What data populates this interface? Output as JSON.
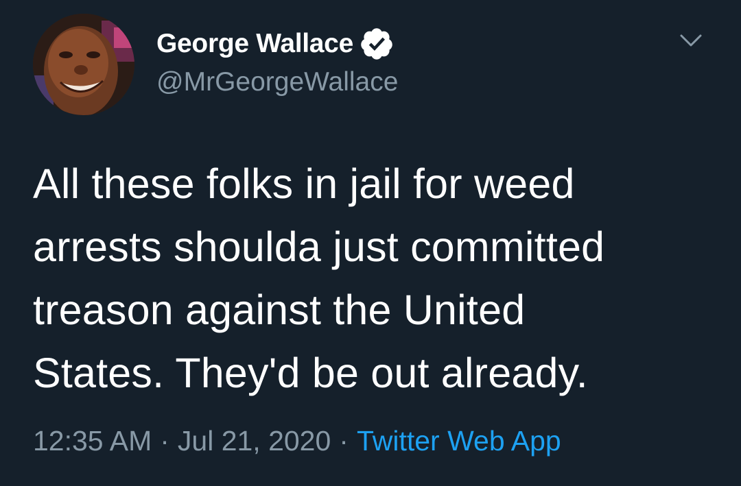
{
  "author": {
    "display_name": "George Wallace",
    "handle": "@MrGeorgeWallace",
    "verified": true,
    "avatar_icon": "profile-photo"
  },
  "tweet": {
    "lines": [
      "All these folks in jail for weed",
      "arrests shoulda just committed",
      "treason against the United",
      "States. They'd be out already."
    ]
  },
  "meta": {
    "time": "12:35 AM",
    "separator": "·",
    "date": "Jul 21, 2020",
    "source": "Twitter Web App"
  },
  "icons": {
    "verified": "verified-badge-icon",
    "menu": "chevron-down-icon"
  },
  "colors": {
    "background": "#15202b",
    "text": "#ffffff",
    "secondary": "#8899a6",
    "accent": "#1da1f2"
  }
}
